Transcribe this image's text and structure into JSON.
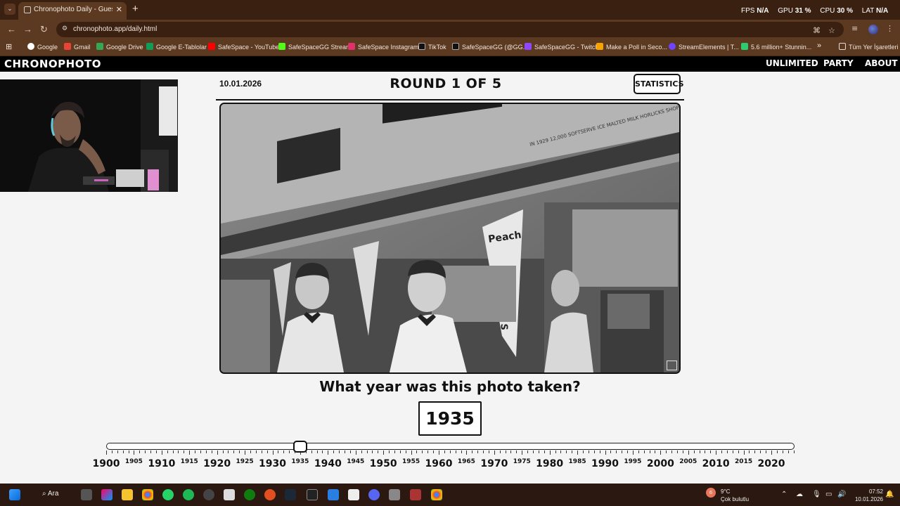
{
  "browser": {
    "tab_title": "Chronophoto Daily - Guess the",
    "new_tab": "+",
    "url": "chronophoto.app/daily.html",
    "perf": {
      "fps_label": "FPS",
      "fps": "N/A",
      "gpu_label": "GPU",
      "gpu": "31 %",
      "cpu_label": "CPU",
      "cpu": "30 %",
      "lat_label": "LAT",
      "lat": "N/A"
    }
  },
  "bookmarks": [
    {
      "label": "Google",
      "color": "#ffffff"
    },
    {
      "label": "Gmail",
      "color": "#ea4335"
    },
    {
      "label": "Google Drive",
      "color": "#34a853"
    },
    {
      "label": "Google E-Tablolar",
      "color": "#0f9d58"
    },
    {
      "label": "SafeSpace - YouTube",
      "color": "#ff0000"
    },
    {
      "label": "SafeSpaceGG Stream",
      "color": "#53fc18"
    },
    {
      "label": "SafeSpace Instagram",
      "color": "#e1306c"
    },
    {
      "label": "TikTok",
      "color": "#111111"
    },
    {
      "label": "SafeSpaceGG (@GG...",
      "color": "#111111"
    },
    {
      "label": "SafeSpaceGG - Twitch",
      "color": "#9146ff"
    },
    {
      "label": "Make a Poll in Seco...",
      "color": "#f4a300"
    },
    {
      "label": "StreamElements | T...",
      "color": "#6e44ff"
    },
    {
      "label": "5.6 million+ Stunnin...",
      "color": "#2ecc71"
    }
  ],
  "bookmarks_more": "»",
  "bookmarks_all": "Tüm Yer İşaretleri",
  "site": {
    "logo": "CHRONOPHOTO",
    "nav": [
      "UNLIMITED",
      "PARTY",
      "ABOUT"
    ]
  },
  "game": {
    "date": "10.01.2026",
    "round": "ROUND 1 OF 5",
    "statistics_label": "STATISTICS",
    "question": "What year was this photo taken?",
    "year": "1935",
    "slider": {
      "min": 1900,
      "max": 2024,
      "value": 1935
    },
    "major_labels": [
      "1900",
      "1910",
      "1920",
      "1930",
      "1940",
      "1950",
      "1960",
      "1970",
      "1980",
      "1990",
      "2000",
      "2010",
      "2020"
    ],
    "minor_labels": [
      "1905",
      "1915",
      "1925",
      "1935",
      "1945",
      "1955",
      "1965",
      "1975",
      "1985",
      "1995",
      "2005",
      "2015"
    ]
  },
  "photo": {
    "sign_text": "IN 1929 12,000 SOFTSERVE ICE MALTED MILK HORLICKS SHOPS DAILY",
    "pennant_top": "Peach",
    "pennant_text": "SUNDAES"
  },
  "taskbar": {
    "search_label": "Ara",
    "weather_temp": "9°C",
    "weather_desc": "Çok bulutlu",
    "weather_badge": "6",
    "time": "07:52",
    "date": "10.01.2026"
  }
}
